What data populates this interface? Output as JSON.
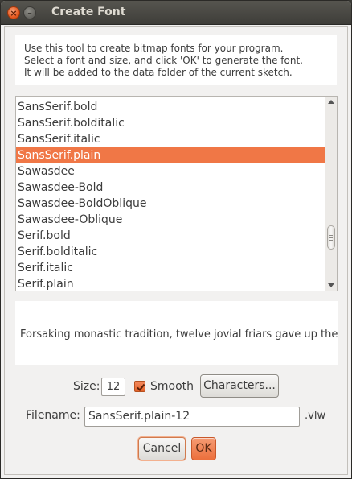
{
  "window": {
    "title": "Create Font",
    "close_glyph": "×",
    "minimize_glyph": "–"
  },
  "instructions": {
    "lines": [
      "Use this tool to create bitmap fonts for your program.",
      "Select a font and size, and click 'OK' to generate the font.",
      "It will be added to the data folder of the current sketch."
    ]
  },
  "font_list": {
    "items": [
      "SansSerif.bold",
      "SansSerif.bolditalic",
      "SansSerif.italic",
      "SansSerif.plain",
      "Sawasdee",
      "Sawasdee-Bold",
      "Sawasdee-BoldOblique",
      "Sawasdee-Oblique",
      "Serif.bold",
      "Serif.bolditalic",
      "Serif.italic",
      "Serif.plain"
    ],
    "selected_index": 3
  },
  "preview": {
    "text": "Forsaking monastic tradition, twelve jovial friars gave up their v"
  },
  "options": {
    "size_label": "Size:",
    "size_value": "12",
    "smooth_label": "Smooth",
    "smooth_checked": true,
    "characters_label": "Characters..."
  },
  "filename": {
    "label": "Filename:",
    "value": "SansSerif.plain-12",
    "extension": ".vlw"
  },
  "buttons": {
    "cancel": "Cancel",
    "ok": "OK"
  },
  "colors": {
    "accent": "#f07746",
    "window_bg": "#f2f1f0",
    "titlebar": "#3e3d39"
  }
}
